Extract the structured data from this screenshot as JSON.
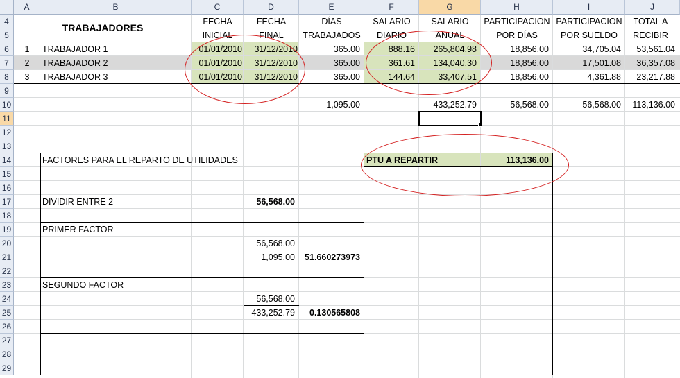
{
  "columns": [
    "A",
    "B",
    "C",
    "D",
    "E",
    "F",
    "G",
    "H",
    "I",
    "J"
  ],
  "rows": [
    "4",
    "5",
    "6",
    "7",
    "8",
    "9",
    "10",
    "11",
    "12",
    "13",
    "14",
    "15",
    "16",
    "17",
    "18",
    "19",
    "20",
    "21",
    "22",
    "23",
    "24",
    "25",
    "26",
    "27",
    "28",
    "29"
  ],
  "header": {
    "trabajadores": "TRABAJADORES",
    "fecha_l1": "FECHA",
    "inicial_l2": "INICIAL",
    "fecha_final_l1": "FECHA",
    "final_l2": "FINAL",
    "dias_l1": "DÍAS",
    "dias_l2": "TRABAJADOS",
    "salario_l1": "SALARIO",
    "diario_l2": "DIARIO",
    "salario_anual_l1": "SALARIO",
    "anual_l2": "ANUAL",
    "part_dias_l1": "PARTICIPACION",
    "part_dias_l2": "POR DÍAS",
    "part_sueldo_l1": "PARTICIPACION",
    "part_sueldo_l2": "POR SUELDO",
    "total_l1": "TOTAL A",
    "total_l2": "RECIBIR"
  },
  "workers": [
    {
      "num": "1",
      "name": "TRABAJADOR 1",
      "fecha_inicial": "01/01/2010",
      "fecha_final": "31/12/2010",
      "dias": "365.00",
      "salario_diario": "888.16",
      "salario_anual": "265,804.98",
      "part_dias": "18,856.00",
      "part_sueldo": "34,705.04",
      "total": "53,561.04"
    },
    {
      "num": "2",
      "name": "TRABAJADOR 2",
      "fecha_inicial": "01/01/2010",
      "fecha_final": "31/12/2010",
      "dias": "365.00",
      "salario_diario": "361.61",
      "salario_anual": "134,040.30",
      "part_dias": "18,856.00",
      "part_sueldo": "17,501.08",
      "total": "36,357.08"
    },
    {
      "num": "3",
      "name": "TRABAJADOR 3",
      "fecha_inicial": "01/01/2010",
      "fecha_final": "31/12/2010",
      "dias": "365.00",
      "salario_diario": "144.64",
      "salario_anual": "33,407.51",
      "part_dias": "18,856.00",
      "part_sueldo": "4,361.88",
      "total": "23,217.88"
    }
  ],
  "totals": {
    "dias": "1,095.00",
    "salario_anual": "433,252.79",
    "part_dias": "56,568.00",
    "part_sueldo": "56,568.00",
    "total": "113,136.00"
  },
  "factores": {
    "title": "FACTORES PARA EL REPARTO DE UTILIDADES",
    "dividir_label": "DIVIDIR ENTRE 2",
    "dividir_value": "56,568.00",
    "primer_label": "PRIMER FACTOR",
    "primer_num": "56,568.00",
    "primer_den": "1,095.00",
    "primer_result": "51.660273973",
    "segundo_label": "SEGUNDO FACTOR",
    "segundo_num": "56,568.00",
    "segundo_den": "433,252.79",
    "segundo_result": "0.130565808"
  },
  "ptu": {
    "label": "PTU A REPARTIR",
    "value": "113,136.00"
  },
  "colors": {
    "highlight_fill": "#d8e4bc",
    "selected_row_fill": "#d9d9d9",
    "annotation": "#d42020",
    "selected_header": "#f9d9a7"
  }
}
